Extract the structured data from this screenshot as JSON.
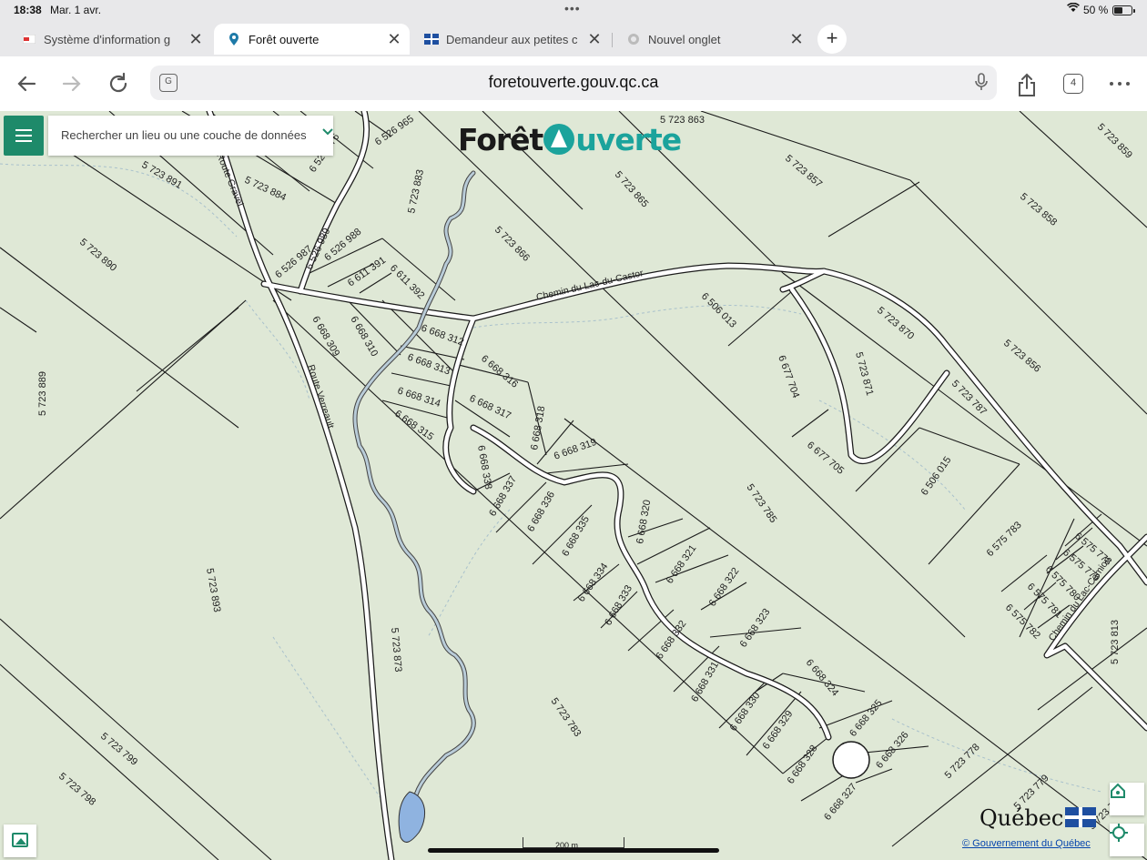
{
  "status_bar": {
    "time": "18:38",
    "date": "Mar. 1 avr.",
    "battery": "50 %"
  },
  "tabs": [
    {
      "label": "Système d'information g",
      "active": false
    },
    {
      "label": "Forêt ouverte",
      "active": true
    },
    {
      "label": "Demandeur aux petites c",
      "active": false
    },
    {
      "label": "Nouvel onglet",
      "active": false
    }
  ],
  "toolbar": {
    "url": "foretouverte.gouv.qc.ca",
    "tab_count": "4"
  },
  "map_ui": {
    "search_placeholder": "Rechercher un lieu ou une couche de données",
    "logo_part1": "Forêt",
    "logo_part2": "uverte",
    "quebec_wordmark": "Québec",
    "copyright": "© Gouvernement du Québec",
    "scale": "200 m"
  },
  "lot_labels": [
    "5 723 863",
    "6 526 965",
    "6 526 976",
    "5 723 891",
    "5 723 884",
    "5 723 883",
    "5 723 865",
    "5 723 857",
    "5 723 859",
    "5 723 858",
    "5 723 866",
    "6 526 987",
    "6 526 989",
    "6 526 988",
    "6 611 391",
    "6 611 392",
    "5 723 890",
    "6 668 309",
    "6 668 310",
    "6 668 312",
    "6 668 313",
    "6 668 314",
    "6 668 315",
    "6 668 316",
    "6 668 317",
    "6 668 318",
    "6 668 319",
    "6 668 338",
    "6 668 337",
    "6 668 336",
    "6 668 335",
    "6 668 320",
    "6 668 334",
    "6 668 333",
    "6 668 321",
    "6 668 322",
    "6 668 332",
    "6 668 323",
    "6 668 331",
    "6 668 330",
    "6 668 329",
    "6 668 324",
    "6 668 325",
    "6 668 328",
    "6 668 326",
    "6 668 327",
    "6 506 013",
    "6 677 704",
    "5 723 871",
    "5 723 870",
    "5 723 856",
    "5 723 787",
    "6 677 705",
    "6 506 015",
    "5 723 785",
    "5 723 783",
    "6 575 783",
    "6 575 778",
    "6 575 779",
    "6 575 780",
    "6 575 781",
    "6 575 782",
    "5 723 813",
    "5 723 889",
    "5 723 893",
    "5 723 873",
    "5 723 799",
    "5 723 798",
    "5 723 778",
    "5 723 779",
    "5 723 78"
  ],
  "road_labels": {
    "castor": "Chemin du Lac-du-Castor",
    "gravel": "Route Gravel",
    "verreault": "Route Verreault",
    "camion": "Chemin du Lac-Camion"
  },
  "icons": {
    "menu": "hamburger-icon",
    "search_chevron": "chevron-down-icon",
    "home": "home-icon",
    "locate": "crosshair-icon",
    "layers": "image-layers-icon"
  }
}
